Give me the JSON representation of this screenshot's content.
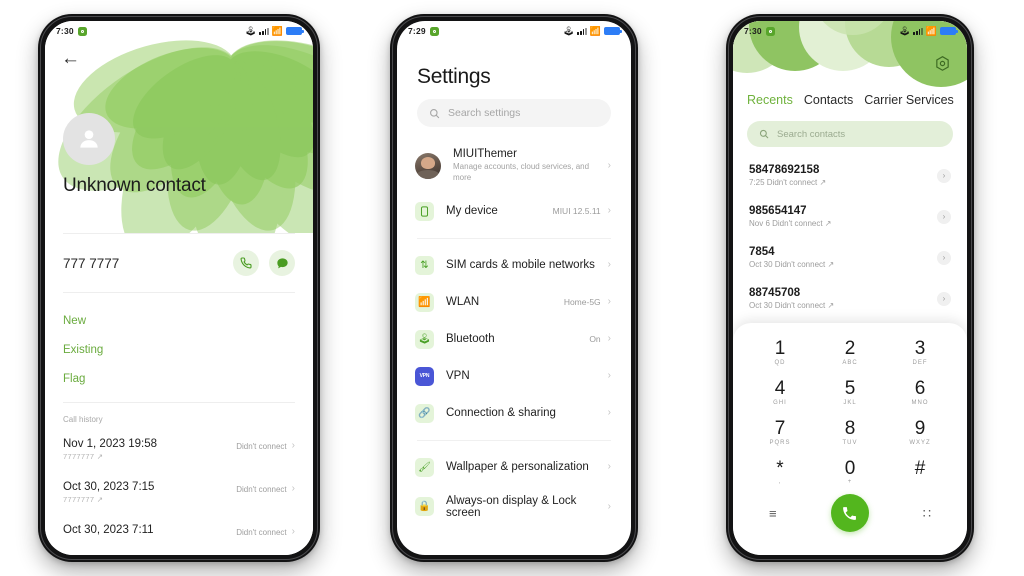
{
  "colors": {
    "green_accent": "#6fb23c",
    "green_call": "#53b61e",
    "light_green_chip": "#e3efd9",
    "battery_blue": "#2d7df6"
  },
  "phone1": {
    "status_bar": {
      "time": "7:30",
      "icons": [
        "bluetooth-icon",
        "signal-icon",
        "wifi-icon",
        "battery-icon"
      ]
    },
    "back_icon": "←",
    "contact_name": "Unknown contact",
    "phone_number": "777 7777",
    "actions": [
      {
        "name": "call-action",
        "icon": "phone-icon"
      },
      {
        "name": "message-action",
        "icon": "message-icon"
      }
    ],
    "links": [
      "New",
      "Existing",
      "Flag"
    ],
    "call_history_label": "Call history",
    "call_history": [
      {
        "date": "Nov 1, 2023 19:58",
        "number": "7777777",
        "status": "Didn't connect"
      },
      {
        "date": "Oct 30, 2023 7:15",
        "number": "7777777",
        "status": "Didn't connect"
      },
      {
        "date": "Oct 30, 2023 7:11",
        "number": "",
        "status": "Didn't connect"
      }
    ]
  },
  "phone2": {
    "status_bar": {
      "time": "7:29"
    },
    "title": "Settings",
    "search_placeholder": "Search settings",
    "groups": [
      {
        "items": [
          {
            "icon": "account-avatar",
            "label": "MIUIThemer",
            "sub": "Manage accounts, cloud services, and more",
            "value": ""
          },
          {
            "icon": "phone-device-icon",
            "label": "My device",
            "sub": "",
            "value": "MIUI 12.5.11"
          }
        ]
      },
      {
        "items": [
          {
            "icon": "sim-arrows-icon",
            "label": "SIM cards & mobile networks",
            "sub": "",
            "value": ""
          },
          {
            "icon": "wifi-icon",
            "label": "WLAN",
            "sub": "",
            "value": "Home-5G"
          },
          {
            "icon": "bluetooth-icon",
            "label": "Bluetooth",
            "sub": "",
            "value": "On"
          },
          {
            "icon": "vpn-icon",
            "label": "VPN",
            "sub": "",
            "value": ""
          },
          {
            "icon": "link-icon",
            "label": "Connection & sharing",
            "sub": "",
            "value": ""
          }
        ]
      },
      {
        "items": [
          {
            "icon": "brush-icon",
            "label": "Wallpaper & personalization",
            "sub": "",
            "value": ""
          },
          {
            "icon": "lock-icon",
            "label": "Always-on display & Lock screen",
            "sub": "",
            "value": ""
          }
        ]
      }
    ]
  },
  "phone3": {
    "status_bar": {
      "time": "7:30"
    },
    "gear_icon": "settings-hex-icon",
    "tabs": [
      {
        "label": "Recents",
        "active": true
      },
      {
        "label": "Contacts",
        "active": false
      },
      {
        "label": "Carrier Services",
        "active": false
      }
    ],
    "search_placeholder": "Search contacts",
    "recents": [
      {
        "number": "58478692158",
        "sub": "7:25 Didn't connect"
      },
      {
        "number": "985654147",
        "sub": "Nov 6 Didn't connect"
      },
      {
        "number": "7854",
        "sub": "Oct 30 Didn't connect"
      },
      {
        "number": "88745708",
        "sub": "Oct 30 Didn't connect"
      }
    ],
    "keypad": [
      {
        "digit": "1",
        "letters": "QD"
      },
      {
        "digit": "2",
        "letters": "ABC"
      },
      {
        "digit": "3",
        "letters": "DEF"
      },
      {
        "digit": "4",
        "letters": "GHI"
      },
      {
        "digit": "5",
        "letters": "JKL"
      },
      {
        "digit": "6",
        "letters": "MNO"
      },
      {
        "digit": "7",
        "letters": "PQRS"
      },
      {
        "digit": "8",
        "letters": "TUV"
      },
      {
        "digit": "9",
        "letters": "WXYZ"
      },
      {
        "digit": "*",
        "letters": ","
      },
      {
        "digit": "0",
        "letters": "+"
      },
      {
        "digit": "#",
        "letters": ""
      }
    ],
    "bottom_bar": {
      "left_icon": "menu-icon",
      "call_icon": "phone-icon",
      "right_icon": "keypad-icon"
    }
  }
}
